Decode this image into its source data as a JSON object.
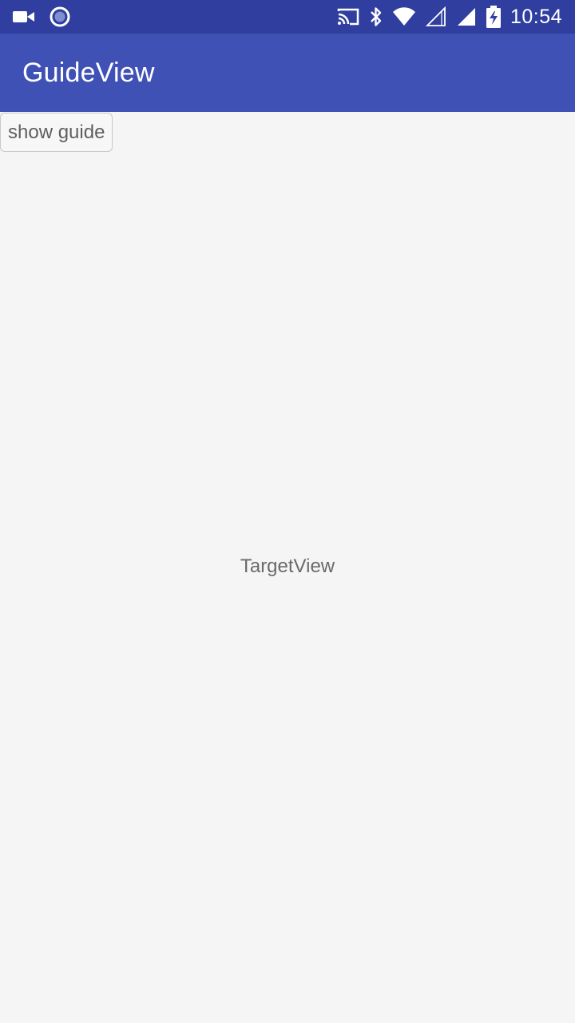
{
  "status_bar": {
    "time": "10:54",
    "icons_left": [
      "video-camera-icon",
      "record-circle-icon"
    ],
    "icons_right": [
      "cast-icon",
      "bluetooth-icon",
      "wifi-icon",
      "signal-empty-icon",
      "signal-full-icon",
      "battery-charging-icon"
    ],
    "background": "#303f9f"
  },
  "app_bar": {
    "title": "GuideView",
    "background": "#3f51b5"
  },
  "content": {
    "show_guide_button": "show guide",
    "target_view": "TargetView",
    "background": "#f5f5f5"
  }
}
